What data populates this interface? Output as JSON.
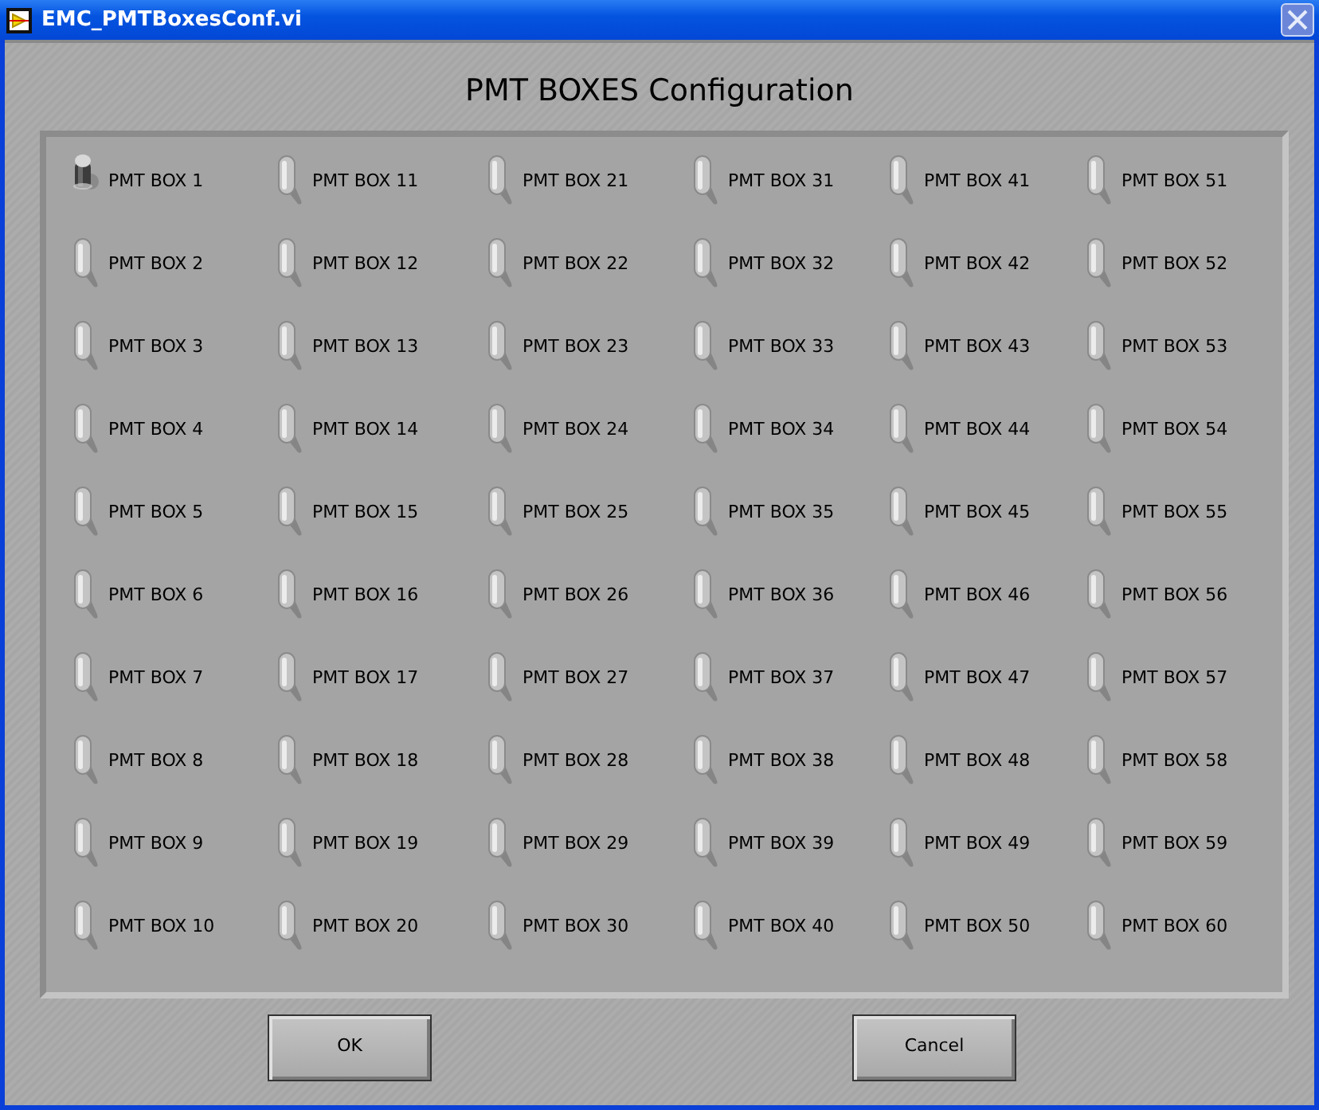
{
  "window": {
    "title": "EMC_PMTBoxesConf.vi"
  },
  "heading": "PMT BOXES Configuration",
  "toggles": [
    {
      "label": "PMT BOX 1",
      "on": true
    },
    {
      "label": "PMT BOX 2",
      "on": false
    },
    {
      "label": "PMT BOX 3",
      "on": false
    },
    {
      "label": "PMT BOX 4",
      "on": false
    },
    {
      "label": "PMT BOX 5",
      "on": false
    },
    {
      "label": "PMT BOX 6",
      "on": false
    },
    {
      "label": "PMT BOX 7",
      "on": false
    },
    {
      "label": "PMT BOX 8",
      "on": false
    },
    {
      "label": "PMT BOX 9",
      "on": false
    },
    {
      "label": "PMT BOX 10",
      "on": false
    },
    {
      "label": "PMT BOX 11",
      "on": false
    },
    {
      "label": "PMT BOX 12",
      "on": false
    },
    {
      "label": "PMT BOX 13",
      "on": false
    },
    {
      "label": "PMT BOX 14",
      "on": false
    },
    {
      "label": "PMT BOX 15",
      "on": false
    },
    {
      "label": "PMT BOX 16",
      "on": false
    },
    {
      "label": "PMT BOX 17",
      "on": false
    },
    {
      "label": "PMT BOX 18",
      "on": false
    },
    {
      "label": "PMT BOX 19",
      "on": false
    },
    {
      "label": "PMT BOX 20",
      "on": false
    },
    {
      "label": "PMT BOX 21",
      "on": false
    },
    {
      "label": "PMT BOX 22",
      "on": false
    },
    {
      "label": "PMT BOX 23",
      "on": false
    },
    {
      "label": "PMT BOX 24",
      "on": false
    },
    {
      "label": "PMT BOX 25",
      "on": false
    },
    {
      "label": "PMT BOX 26",
      "on": false
    },
    {
      "label": "PMT BOX 27",
      "on": false
    },
    {
      "label": "PMT BOX 28",
      "on": false
    },
    {
      "label": "PMT BOX 29",
      "on": false
    },
    {
      "label": "PMT BOX 30",
      "on": false
    },
    {
      "label": "PMT BOX 31",
      "on": false
    },
    {
      "label": "PMT BOX 32",
      "on": false
    },
    {
      "label": "PMT BOX 33",
      "on": false
    },
    {
      "label": "PMT BOX 34",
      "on": false
    },
    {
      "label": "PMT BOX 35",
      "on": false
    },
    {
      "label": "PMT BOX 36",
      "on": false
    },
    {
      "label": "PMT BOX 37",
      "on": false
    },
    {
      "label": "PMT BOX 38",
      "on": false
    },
    {
      "label": "PMT BOX 39",
      "on": false
    },
    {
      "label": "PMT BOX 40",
      "on": false
    },
    {
      "label": "PMT BOX 41",
      "on": false
    },
    {
      "label": "PMT BOX 42",
      "on": false
    },
    {
      "label": "PMT BOX 43",
      "on": false
    },
    {
      "label": "PMT BOX 44",
      "on": false
    },
    {
      "label": "PMT BOX 45",
      "on": false
    },
    {
      "label": "PMT BOX 46",
      "on": false
    },
    {
      "label": "PMT BOX 47",
      "on": false
    },
    {
      "label": "PMT BOX 48",
      "on": false
    },
    {
      "label": "PMT BOX 49",
      "on": false
    },
    {
      "label": "PMT BOX 50",
      "on": false
    },
    {
      "label": "PMT BOX 51",
      "on": false
    },
    {
      "label": "PMT BOX 52",
      "on": false
    },
    {
      "label": "PMT BOX 53",
      "on": false
    },
    {
      "label": "PMT BOX 54",
      "on": false
    },
    {
      "label": "PMT BOX 55",
      "on": false
    },
    {
      "label": "PMT BOX 56",
      "on": false
    },
    {
      "label": "PMT BOX 57",
      "on": false
    },
    {
      "label": "PMT BOX 58",
      "on": false
    },
    {
      "label": "PMT BOX 59",
      "on": false
    },
    {
      "label": "PMT BOX 60",
      "on": false
    }
  ],
  "buttons": [
    "OK",
    "Cancel"
  ]
}
